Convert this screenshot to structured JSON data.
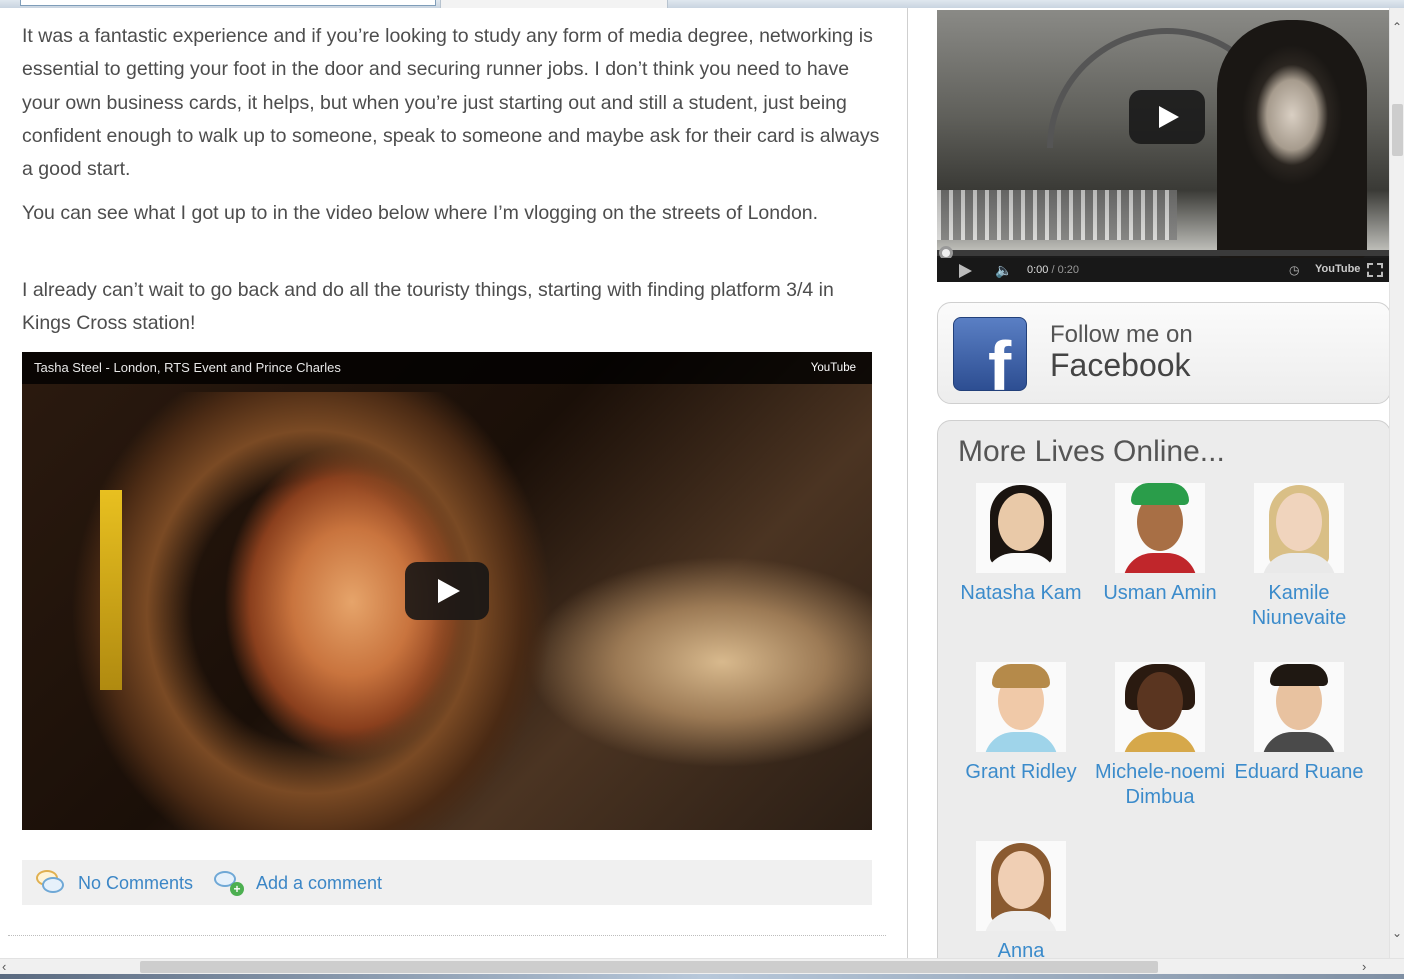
{
  "article": {
    "paragraphs": [
      "It was a fantastic experience and if you’re looking to study any form of media degree, networking is essential to getting your foot in the door and securing runner jobs. I don’t think you need to have your own business cards, it helps, but when you’re just starting out and still a student, just being confident enough to walk up to someone, speak to someone and maybe ask for their card is always a good start.",
      "You can see what I got up to in the video below where I’m vlogging on the streets of London.",
      "I already can’t wait to go back and do all the touristy things, starting with finding platform 3/4 in Kings Cross station!"
    ],
    "video": {
      "title": "Tasha Steel - London, RTS Event and Prince Charles",
      "provider": "YouTube"
    },
    "comments": {
      "count_label": "No Comments",
      "add_label": "Add a comment"
    }
  },
  "sidebar": {
    "video": {
      "current_time": "0:00",
      "separator": " / ",
      "duration": "0:20",
      "logo_text": "YouTube"
    },
    "facebook": {
      "line1": "Follow me on",
      "line2": "Facebook",
      "logo_letter": "f"
    },
    "lives": {
      "title": "More Lives Online...",
      "people": [
        {
          "name": "Natasha Kam"
        },
        {
          "name": "Usman Amin"
        },
        {
          "name": "Kamile Niunevaite"
        },
        {
          "name": "Grant Ridley"
        },
        {
          "name": "Michele-noemi Dimbua"
        },
        {
          "name": "Eduard Ruane"
        },
        {
          "name": "Anna"
        }
      ]
    }
  },
  "colors": {
    "link": "#3b8bcb",
    "body_text": "#4d4d4d",
    "sidebar_bg": "#ececec"
  }
}
